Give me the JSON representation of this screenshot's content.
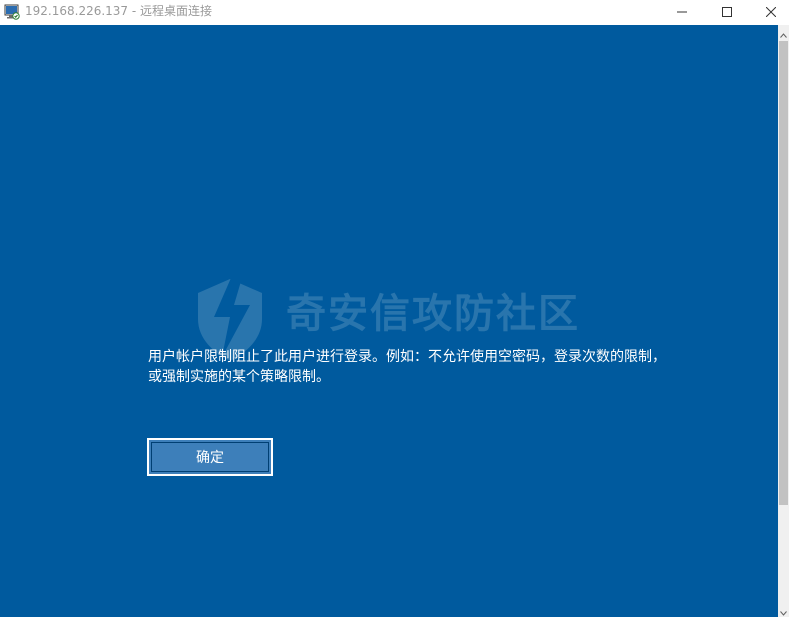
{
  "window": {
    "title": "192.168.226.137 - 远程桌面连接",
    "app_icon": "remote-desktop-icon",
    "controls": {
      "minimize": "minimize-icon",
      "maximize": "maximize-icon",
      "close": "close-icon"
    }
  },
  "remote_screen": {
    "background_color": "#005a9e",
    "watermark": {
      "text": "奇安信攻防社区",
      "icon": "shield-lightning-icon"
    },
    "message": {
      "line1": "用户帐户限制阻止了此用户进行登录。例如：不允许使用空密码，登录次数的限制，",
      "line2": "或强制实施的某个策略限制。"
    },
    "ok_button": {
      "label": "确定",
      "background_color": "#3d7fba"
    }
  },
  "scrollbar": {
    "up_icon": "scroll-up-arrow-icon",
    "down_icon": "scroll-down-arrow-icon"
  }
}
